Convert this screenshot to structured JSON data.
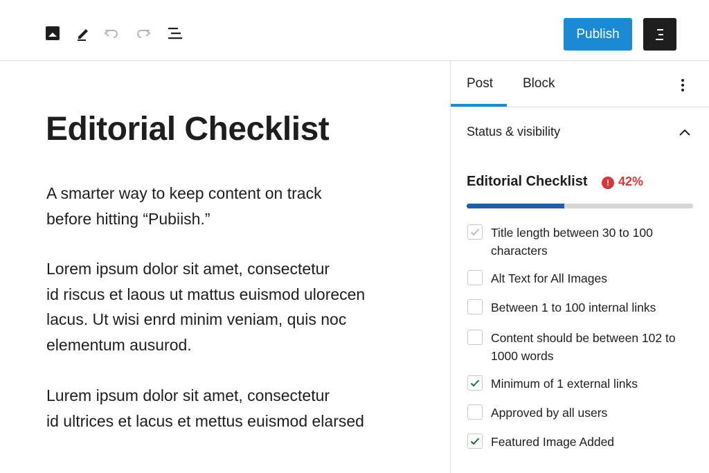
{
  "toolbar": {
    "icons": [
      "image-icon",
      "pencil-icon",
      "undo-icon",
      "redo-icon",
      "list-view-icon"
    ],
    "publish_label": "Publish",
    "accent_color": "#1b8ad3"
  },
  "editor": {
    "title": "Editorial Checklist",
    "paragraphs": [
      [
        "A smarter way to keep content on track",
        "before hitting “Pubiish.”"
      ],
      [
        "Lorem ipsum dolor sit amet, consectetur",
        "id riscus et laous ut mattus euismod ulorecen",
        "lacus. Ut wisi enrd minim veniam, quis noc",
        "elementum ausurod."
      ],
      [
        "Lurem ipsum dolor sit amet, consectetur",
        "id ultrices et lacus et mettus euismod elarsed"
      ]
    ]
  },
  "sidebar": {
    "tabs": [
      {
        "label": "Post",
        "active": true
      },
      {
        "label": "Block",
        "active": false
      }
    ],
    "panel_title": "Status & visibility",
    "checklist": {
      "title": "Editorial Checklist",
      "error_badge": "!",
      "percent_label": "42%",
      "progress": 0.43,
      "error_color": "#d63638",
      "progress_color": "#1d5ea8",
      "items": [
        {
          "label": "Title length between 30 to 100 characters",
          "checked": true,
          "disabled": true
        },
        {
          "label": "Alt Text for All Images",
          "checked": false
        },
        {
          "label": "Between 1 to 100 internal links",
          "checked": false
        },
        {
          "label": "Content should be between 102 to 1000 words",
          "checked": false
        },
        {
          "label": "Minimum of 1 external links",
          "checked": true
        },
        {
          "label": "Approved by all users",
          "checked": false
        },
        {
          "label": "Featured Image Added",
          "checked": true
        }
      ]
    }
  }
}
